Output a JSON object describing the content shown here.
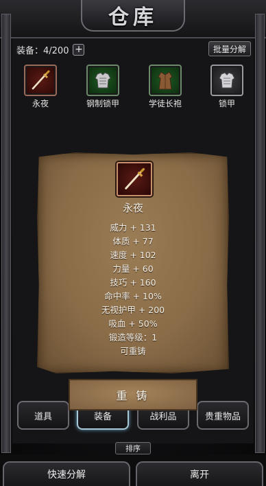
{
  "title": "仓库",
  "capacity": {
    "label": "装备：4/200",
    "plus": "+"
  },
  "batch_button": "批量分解",
  "items": [
    {
      "name": "永夜",
      "icon": "sword-icon",
      "color": "#5a1a14"
    },
    {
      "name": "钢制锁甲",
      "icon": "chest-armor-icon",
      "color": "#1f5a22"
    },
    {
      "name": "学徒长袍",
      "icon": "robe-icon",
      "color": "#1f5a22"
    },
    {
      "name": "锁甲",
      "icon": "chest-armor-icon",
      "color": "#3e3e42"
    }
  ],
  "detail": {
    "name": "永夜",
    "icon": "sword-icon",
    "stats": [
      "威力 + 131",
      "体质 + 77",
      "速度 + 102",
      "力量 + 60",
      "技巧 + 160",
      "命中率 + 10%",
      "无视护甲 + 200",
      "吸血 + 50%",
      "锻造等级：1",
      "可重铸"
    ]
  },
  "recast_button": "重 铸",
  "tabs": [
    {
      "label": "道具",
      "active": false
    },
    {
      "label": "装备",
      "active": true
    },
    {
      "label": "战利品",
      "active": false
    },
    {
      "label": "贵重物品",
      "active": false
    }
  ],
  "sort_button": "排序",
  "quick_decompose_button": "快速分解",
  "leave_button": "离开"
}
